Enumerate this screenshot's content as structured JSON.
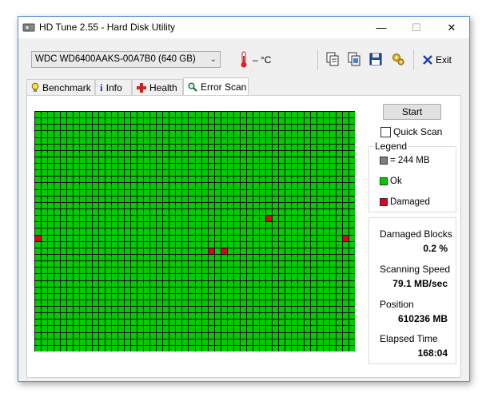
{
  "window": {
    "title": "HD Tune 2.55 - Hard Disk Utility",
    "controls": {
      "minimize": "—",
      "maximize": "☐",
      "close": "✕"
    }
  },
  "toolbar": {
    "drive": "WDC WD6400AAKS-00A7B0 (640 GB)",
    "temperature": "– °C",
    "exit_label": "Exit",
    "icons": [
      "copy-text-icon",
      "copy-screenshot-icon",
      "save-icon",
      "options-icon"
    ]
  },
  "tabs": [
    {
      "label": "Benchmark",
      "icon": "lightbulb-icon"
    },
    {
      "label": "Info",
      "icon": "info-icon"
    },
    {
      "label": "Health",
      "icon": "health-cross-icon"
    },
    {
      "label": "Error Scan",
      "icon": "magnifier-icon",
      "active": true
    }
  ],
  "scan": {
    "start_label": "Start",
    "quick_scan_label": "Quick Scan",
    "quick_scan_checked": false,
    "grid": {
      "columns": 50,
      "rows": 37,
      "damaged_blocks": [
        [
          36,
          16
        ],
        [
          0,
          19
        ],
        [
          48,
          19
        ],
        [
          27,
          21
        ],
        [
          29,
          21
        ]
      ]
    }
  },
  "legend": {
    "title": "Legend",
    "items": [
      {
        "label": "= 244 MB",
        "color": "#808080"
      },
      {
        "label": "Ok",
        "color": "#00cc00"
      },
      {
        "label": "Damaged",
        "color": "#e00020"
      }
    ]
  },
  "stats": {
    "damaged_blocks_label": "Damaged Blocks",
    "damaged_blocks_value": "0.2 %",
    "scanning_speed_label": "Scanning Speed",
    "scanning_speed_value": "79.1 MB/sec",
    "position_label": "Position",
    "position_value": "610236 MB",
    "elapsed_time_label": "Elapsed Time",
    "elapsed_time_value": "168:04"
  },
  "colors": {
    "ok_block": "#00cc00",
    "damaged_block": "#e00020",
    "grid_line": "#101010",
    "accent_border": "#5a8fd6"
  }
}
